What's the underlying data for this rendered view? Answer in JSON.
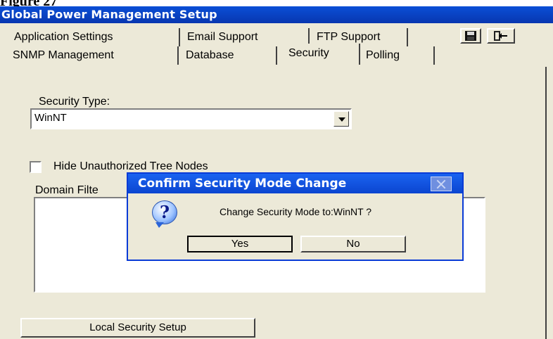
{
  "caption": "Figure 27",
  "window": {
    "title": "Global Power Management Setup"
  },
  "tabs_row1": [
    "Application Settings",
    "Email Support",
    "FTP Support"
  ],
  "tabs_row2": [
    "SNMP Management",
    "Database",
    "Security",
    "Polling"
  ],
  "toolbar": {
    "save_icon": "floppy-disk-icon",
    "exit_icon": "exit-door-icon"
  },
  "security": {
    "type_label": "Security Type:",
    "type_value": "WinNT",
    "hide_label": "Hide Unauthorized Tree Nodes",
    "hide_checked": false,
    "domain_label": "Domain Filte",
    "local_button": "Local Security Setup"
  },
  "dialog": {
    "title": "Confirm Security Mode Change",
    "message": "Change Security Mode to:WinNT ?",
    "yes": "Yes",
    "no": "No",
    "icon": "question-icon"
  },
  "colors": {
    "titlebar": "#0836b0",
    "dialog_border": "#0a3bd6",
    "face": "#ece9d8"
  }
}
